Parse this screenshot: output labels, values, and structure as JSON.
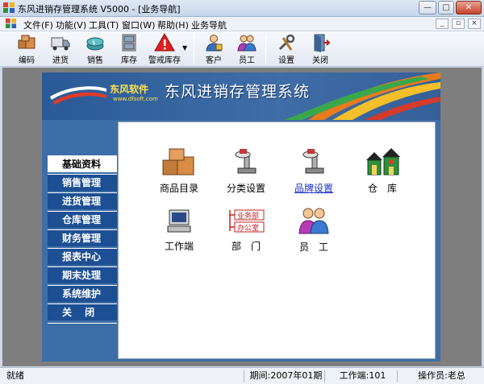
{
  "window": {
    "title": "东风进销存管理系统 V5000 - [业务导航]",
    "minimize": "—",
    "maximize": "□",
    "close": "✕"
  },
  "menu": {
    "items": [
      "文件(F)",
      "功能(V)",
      "工具(T)",
      "窗口(W)",
      "帮助(H)",
      "业务导航"
    ],
    "mdi_minimize": "_",
    "mdi_restore": "▫",
    "mdi_close": "×"
  },
  "toolbar": {
    "items": [
      {
        "label": "编码",
        "icon": "boxes-icon"
      },
      {
        "label": "进货",
        "icon": "truck-icon"
      },
      {
        "label": "销售",
        "icon": "coins-icon"
      },
      {
        "label": "库存",
        "icon": "cabinet-icon"
      },
      {
        "label": "警戒库存",
        "icon": "warning-icon"
      },
      {
        "label": "客户",
        "icon": "customer-icon"
      },
      {
        "label": "员工",
        "icon": "staff-icon"
      },
      {
        "label": "设置",
        "icon": "tools-icon"
      },
      {
        "label": "关闭",
        "icon": "exit-door-icon"
      }
    ],
    "dropdown_arrow": "▼"
  },
  "banner": {
    "logo_text": "东风软件",
    "logo_sub": "www.dfsoft.com",
    "title": "东风进销存管理系统"
  },
  "nav": {
    "items": [
      "基础资料",
      "销售管理",
      "进货管理",
      "仓库管理",
      "财务管理",
      "报表中心",
      "期末处理",
      "系统维护",
      "关　 闭"
    ],
    "active_index": 0
  },
  "content": {
    "items": [
      {
        "label": "商品目录",
        "icon": "goods-boxes-icon",
        "link": false
      },
      {
        "label": "分类设置",
        "icon": "category-scale-icon",
        "link": false
      },
      {
        "label": "品牌设置",
        "icon": "brand-scale-icon",
        "link": true
      },
      {
        "label": "仓　库",
        "icon": "warehouse-icon",
        "link": false
      },
      {
        "label": "工作端",
        "icon": "computer-icon",
        "link": false
      },
      {
        "label": "部　门",
        "icon": "org-chart-icon",
        "link": false
      },
      {
        "label": "员　工",
        "icon": "people-icon",
        "link": false
      }
    ],
    "org_chart": {
      "top": "业务部",
      "bottom": "办公室"
    }
  },
  "status": {
    "left": "就绪",
    "period": "期间:2007年01期",
    "workstation": "工作端:101",
    "operator": "操作员:老总"
  },
  "colors": {
    "nav_bg": "#1c4f93",
    "panel_bg": "#3e6ea6",
    "mdi_bg": "#7e7e7e",
    "link": "#1830c8"
  }
}
